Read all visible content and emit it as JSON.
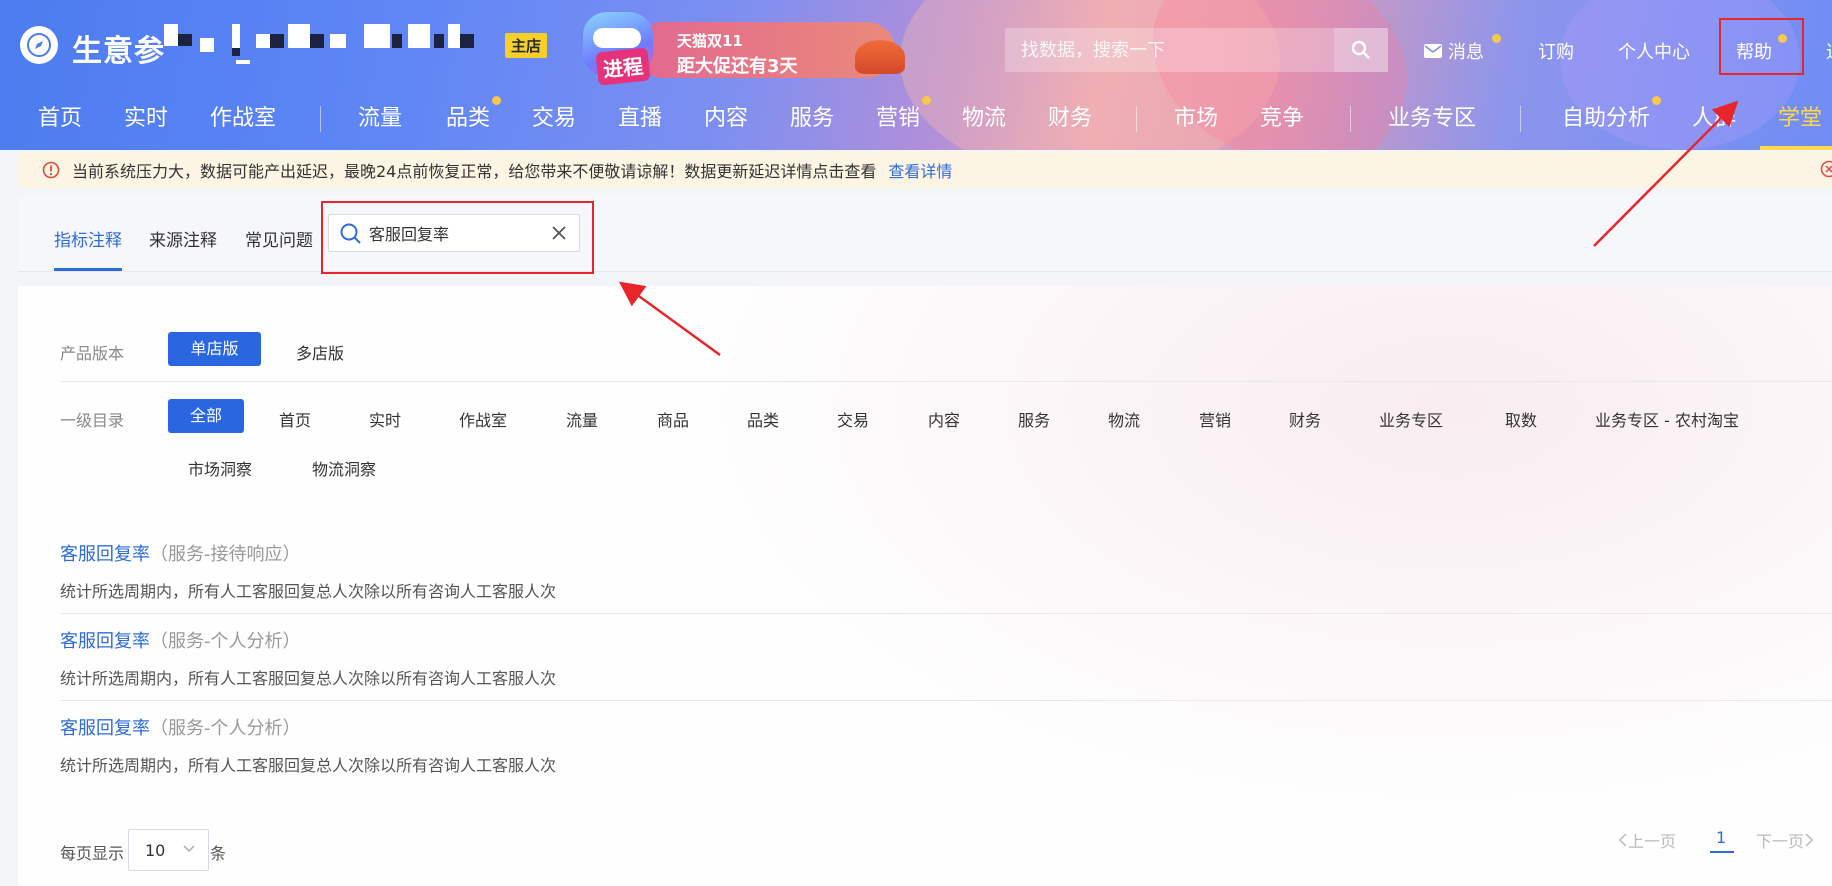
{
  "header": {
    "logo_text": "生意参",
    "shop_badge": "主店",
    "promo": {
      "badge": "进程",
      "line1": "天猫双11",
      "line2": "距大促还有3天"
    },
    "search_placeholder": "找数据，搜索一下",
    "links": {
      "messages": "消息",
      "subscribe": "订购",
      "personal": "个人中心",
      "help": "帮助",
      "cutoff": "退"
    },
    "nav": [
      {
        "label": "首页"
      },
      {
        "label": "实时"
      },
      {
        "label": "作战室"
      },
      {
        "label": "流量"
      },
      {
        "label": "品类"
      },
      {
        "label": "交易"
      },
      {
        "label": "直播"
      },
      {
        "label": "内容"
      },
      {
        "label": "服务"
      },
      {
        "label": "营销"
      },
      {
        "label": "物流"
      },
      {
        "label": "财务"
      },
      {
        "label": "市场"
      },
      {
        "label": "竞争"
      },
      {
        "label": "业务专区"
      },
      {
        "label": "自助分析"
      },
      {
        "label": "人群"
      },
      {
        "label": "学堂"
      }
    ]
  },
  "notice": {
    "text": "当前系统压力大，数据可能产出延迟，最晚24点前恢复正常，给您带来不便敬请谅解！数据更新延迟详情点击查看",
    "link": "查看详情"
  },
  "tabs": {
    "indicator_notes": "指标注释",
    "source_notes": "来源注释",
    "faq": "常见问题",
    "search_value": "客服回复率"
  },
  "filters": {
    "edition_label": "产品版本",
    "editions": [
      "单店版",
      "多店版"
    ],
    "category_label": "一级目录",
    "categories": [
      "全部",
      "首页",
      "实时",
      "作战室",
      "流量",
      "商品",
      "品类",
      "交易",
      "内容",
      "服务",
      "物流",
      "营销",
      "财务",
      "业务专区",
      "取数",
      "业务专区 - 农村淘宝",
      "市场洞察",
      "物流洞察"
    ]
  },
  "results": [
    {
      "name": "客服回复率",
      "tag": "（服务-接待响应）",
      "desc": "统计所选周期内，所有人工客服回复总人次除以所有咨询人工客服人次"
    },
    {
      "name": "客服回复率",
      "tag": "（服务-个人分析）",
      "desc": "统计所选周期内，所有人工客服回复总人次除以所有咨询人工客服人次"
    },
    {
      "name": "客服回复率",
      "tag": "（服务-个人分析）",
      "desc": "统计所选周期内，所有人工客服回复总人次除以所有咨询人工客服人次"
    }
  ],
  "pagination": {
    "per_page_label": "每页显示",
    "per_page_value": "10",
    "unit": "条",
    "prev": "上一页",
    "current": "1",
    "next": "下一页"
  },
  "colors": {
    "accent": "#2f6cd8",
    "highlight": "#e8252a",
    "active_nav": "#ffd84c"
  }
}
